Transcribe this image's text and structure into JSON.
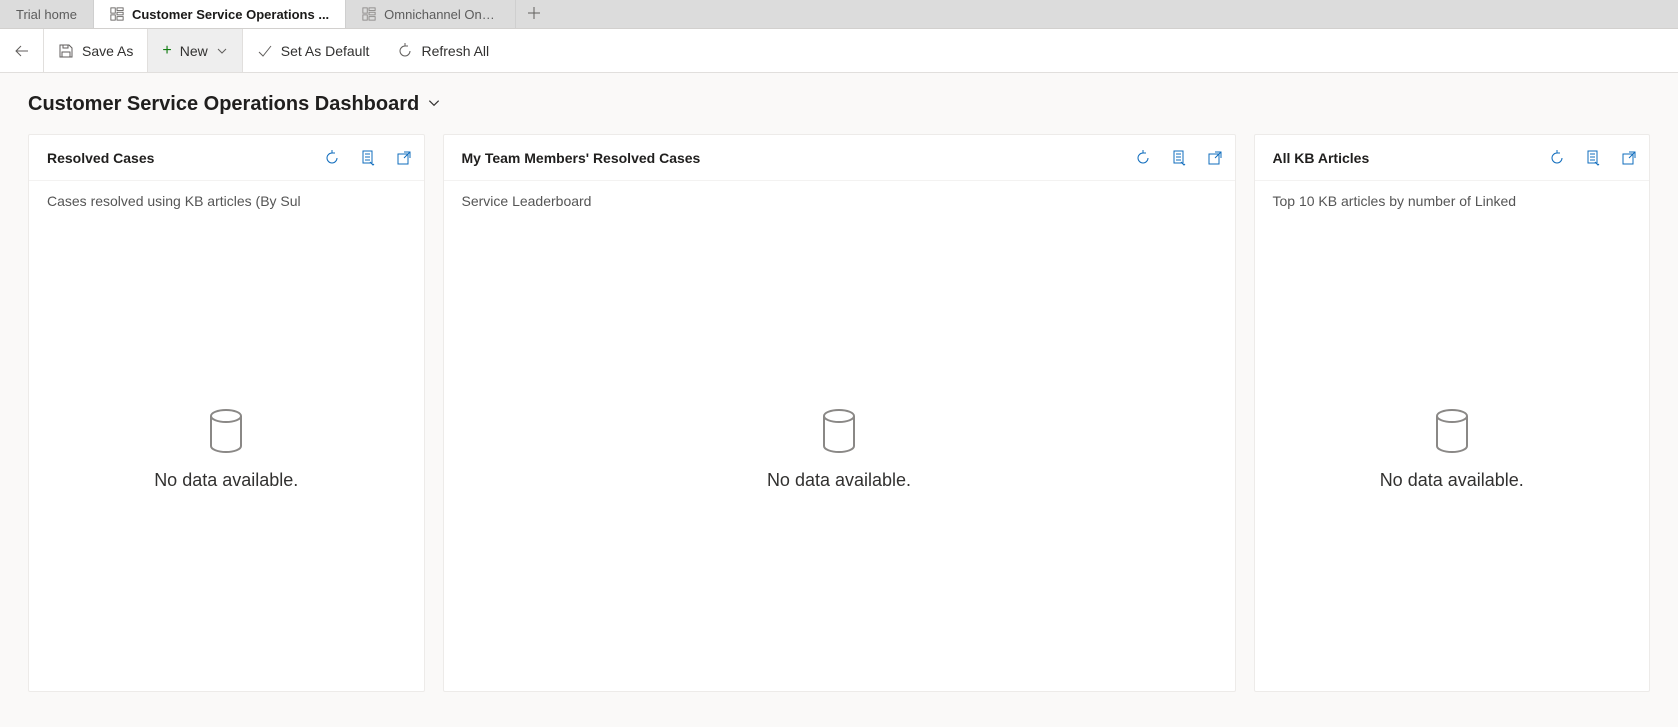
{
  "tabs": {
    "home": "Trial home",
    "active": "Customer Service Operations ...",
    "third": "Omnichannel Ong..."
  },
  "commandbar": {
    "saveas": "Save As",
    "new": "New",
    "setdefault": "Set As Default",
    "refresh": "Refresh All"
  },
  "page_title": "Customer Service Operations Dashboard",
  "panel_icons": {
    "refresh": "refresh",
    "records": "view-records",
    "popout": "pop-out"
  },
  "panels": {
    "resolved": {
      "title": "Resolved Cases",
      "subtitle": "Cases resolved using KB articles (By Sul",
      "empty": "No data available."
    },
    "team": {
      "title": "My Team Members' Resolved Cases",
      "subtitle": "Service Leaderboard",
      "empty": "No data available."
    },
    "kb": {
      "title": "All KB Articles",
      "subtitle": "Top 10 KB articles by number of Linked",
      "empty": "No data available."
    }
  }
}
